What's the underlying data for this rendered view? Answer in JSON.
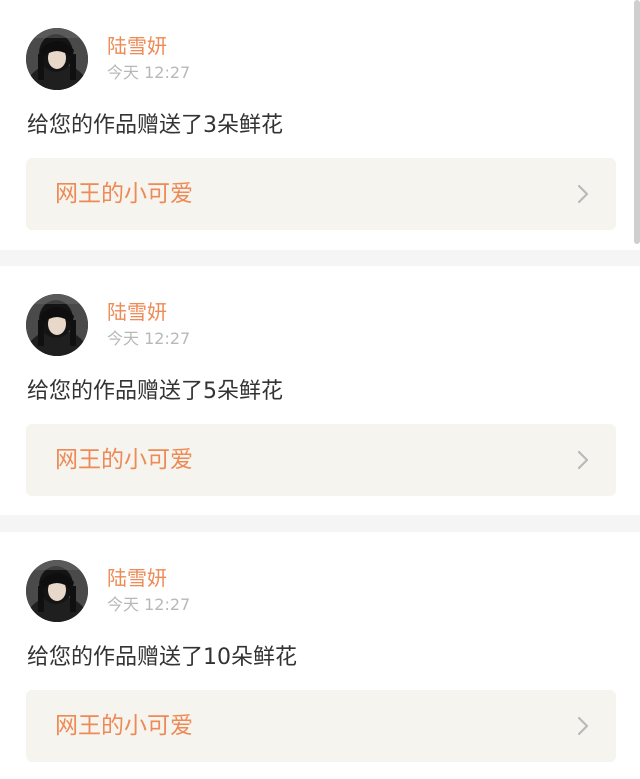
{
  "colors": {
    "accent": "#ee8a55",
    "message_text": "#333333",
    "timestamp": "#b8b8b8",
    "link_bg": "#f5f4ef",
    "page_bg": "#f6f5f5"
  },
  "notifications": [
    {
      "username": "陆雪妍",
      "timestamp": "今天 12:27",
      "message": "给您的作品赠送了3朵鲜花",
      "work_title": "网王的小可爱",
      "icon": "chevron-right-icon"
    },
    {
      "username": "陆雪妍",
      "timestamp": "今天 12:27",
      "message": "给您的作品赠送了5朵鲜花",
      "work_title": "网王的小可爱",
      "icon": "chevron-right-icon"
    },
    {
      "username": "陆雪妍",
      "timestamp": "今天 12:27",
      "message": "给您的作品赠送了10朵鲜花",
      "work_title": "网王的小可爱",
      "icon": "chevron-right-icon"
    }
  ]
}
